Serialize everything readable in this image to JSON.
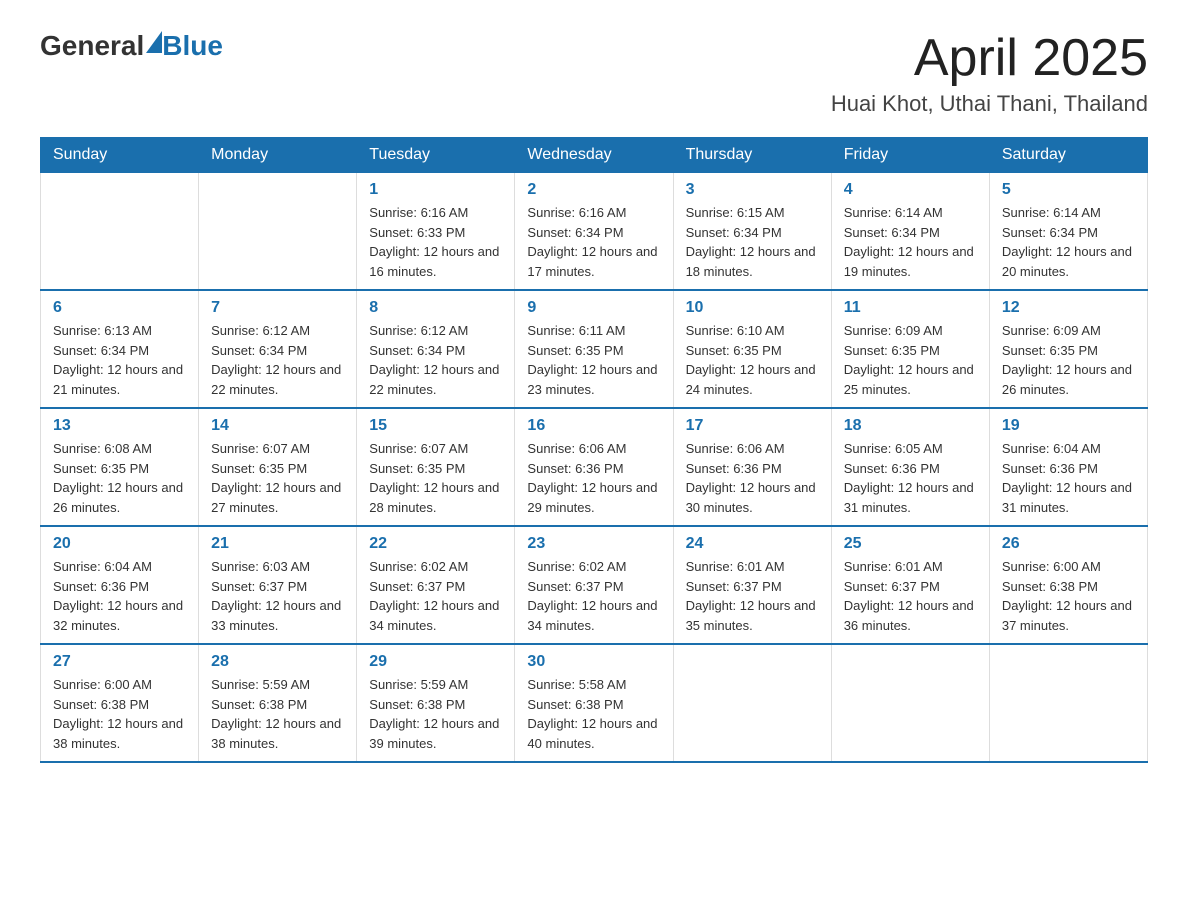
{
  "logo": {
    "text_general": "General",
    "text_blue": "Blue"
  },
  "title": "April 2025",
  "location": "Huai Khot, Uthai Thani, Thailand",
  "weekdays": [
    "Sunday",
    "Monday",
    "Tuesday",
    "Wednesday",
    "Thursday",
    "Friday",
    "Saturday"
  ],
  "weeks": [
    [
      {
        "day": "",
        "sunrise": "",
        "sunset": "",
        "daylight": ""
      },
      {
        "day": "",
        "sunrise": "",
        "sunset": "",
        "daylight": ""
      },
      {
        "day": "1",
        "sunrise": "Sunrise: 6:16 AM",
        "sunset": "Sunset: 6:33 PM",
        "daylight": "Daylight: 12 hours and 16 minutes."
      },
      {
        "day": "2",
        "sunrise": "Sunrise: 6:16 AM",
        "sunset": "Sunset: 6:34 PM",
        "daylight": "Daylight: 12 hours and 17 minutes."
      },
      {
        "day": "3",
        "sunrise": "Sunrise: 6:15 AM",
        "sunset": "Sunset: 6:34 PM",
        "daylight": "Daylight: 12 hours and 18 minutes."
      },
      {
        "day": "4",
        "sunrise": "Sunrise: 6:14 AM",
        "sunset": "Sunset: 6:34 PM",
        "daylight": "Daylight: 12 hours and 19 minutes."
      },
      {
        "day": "5",
        "sunrise": "Sunrise: 6:14 AM",
        "sunset": "Sunset: 6:34 PM",
        "daylight": "Daylight: 12 hours and 20 minutes."
      }
    ],
    [
      {
        "day": "6",
        "sunrise": "Sunrise: 6:13 AM",
        "sunset": "Sunset: 6:34 PM",
        "daylight": "Daylight: 12 hours and 21 minutes."
      },
      {
        "day": "7",
        "sunrise": "Sunrise: 6:12 AM",
        "sunset": "Sunset: 6:34 PM",
        "daylight": "Daylight: 12 hours and 22 minutes."
      },
      {
        "day": "8",
        "sunrise": "Sunrise: 6:12 AM",
        "sunset": "Sunset: 6:34 PM",
        "daylight": "Daylight: 12 hours and 22 minutes."
      },
      {
        "day": "9",
        "sunrise": "Sunrise: 6:11 AM",
        "sunset": "Sunset: 6:35 PM",
        "daylight": "Daylight: 12 hours and 23 minutes."
      },
      {
        "day": "10",
        "sunrise": "Sunrise: 6:10 AM",
        "sunset": "Sunset: 6:35 PM",
        "daylight": "Daylight: 12 hours and 24 minutes."
      },
      {
        "day": "11",
        "sunrise": "Sunrise: 6:09 AM",
        "sunset": "Sunset: 6:35 PM",
        "daylight": "Daylight: 12 hours and 25 minutes."
      },
      {
        "day": "12",
        "sunrise": "Sunrise: 6:09 AM",
        "sunset": "Sunset: 6:35 PM",
        "daylight": "Daylight: 12 hours and 26 minutes."
      }
    ],
    [
      {
        "day": "13",
        "sunrise": "Sunrise: 6:08 AM",
        "sunset": "Sunset: 6:35 PM",
        "daylight": "Daylight: 12 hours and 26 minutes."
      },
      {
        "day": "14",
        "sunrise": "Sunrise: 6:07 AM",
        "sunset": "Sunset: 6:35 PM",
        "daylight": "Daylight: 12 hours and 27 minutes."
      },
      {
        "day": "15",
        "sunrise": "Sunrise: 6:07 AM",
        "sunset": "Sunset: 6:35 PM",
        "daylight": "Daylight: 12 hours and 28 minutes."
      },
      {
        "day": "16",
        "sunrise": "Sunrise: 6:06 AM",
        "sunset": "Sunset: 6:36 PM",
        "daylight": "Daylight: 12 hours and 29 minutes."
      },
      {
        "day": "17",
        "sunrise": "Sunrise: 6:06 AM",
        "sunset": "Sunset: 6:36 PM",
        "daylight": "Daylight: 12 hours and 30 minutes."
      },
      {
        "day": "18",
        "sunrise": "Sunrise: 6:05 AM",
        "sunset": "Sunset: 6:36 PM",
        "daylight": "Daylight: 12 hours and 31 minutes."
      },
      {
        "day": "19",
        "sunrise": "Sunrise: 6:04 AM",
        "sunset": "Sunset: 6:36 PM",
        "daylight": "Daylight: 12 hours and 31 minutes."
      }
    ],
    [
      {
        "day": "20",
        "sunrise": "Sunrise: 6:04 AM",
        "sunset": "Sunset: 6:36 PM",
        "daylight": "Daylight: 12 hours and 32 minutes."
      },
      {
        "day": "21",
        "sunrise": "Sunrise: 6:03 AM",
        "sunset": "Sunset: 6:37 PM",
        "daylight": "Daylight: 12 hours and 33 minutes."
      },
      {
        "day": "22",
        "sunrise": "Sunrise: 6:02 AM",
        "sunset": "Sunset: 6:37 PM",
        "daylight": "Daylight: 12 hours and 34 minutes."
      },
      {
        "day": "23",
        "sunrise": "Sunrise: 6:02 AM",
        "sunset": "Sunset: 6:37 PM",
        "daylight": "Daylight: 12 hours and 34 minutes."
      },
      {
        "day": "24",
        "sunrise": "Sunrise: 6:01 AM",
        "sunset": "Sunset: 6:37 PM",
        "daylight": "Daylight: 12 hours and 35 minutes."
      },
      {
        "day": "25",
        "sunrise": "Sunrise: 6:01 AM",
        "sunset": "Sunset: 6:37 PM",
        "daylight": "Daylight: 12 hours and 36 minutes."
      },
      {
        "day": "26",
        "sunrise": "Sunrise: 6:00 AM",
        "sunset": "Sunset: 6:38 PM",
        "daylight": "Daylight: 12 hours and 37 minutes."
      }
    ],
    [
      {
        "day": "27",
        "sunrise": "Sunrise: 6:00 AM",
        "sunset": "Sunset: 6:38 PM",
        "daylight": "Daylight: 12 hours and 38 minutes."
      },
      {
        "day": "28",
        "sunrise": "Sunrise: 5:59 AM",
        "sunset": "Sunset: 6:38 PM",
        "daylight": "Daylight: 12 hours and 38 minutes."
      },
      {
        "day": "29",
        "sunrise": "Sunrise: 5:59 AM",
        "sunset": "Sunset: 6:38 PM",
        "daylight": "Daylight: 12 hours and 39 minutes."
      },
      {
        "day": "30",
        "sunrise": "Sunrise: 5:58 AM",
        "sunset": "Sunset: 6:38 PM",
        "daylight": "Daylight: 12 hours and 40 minutes."
      },
      {
        "day": "",
        "sunrise": "",
        "sunset": "",
        "daylight": ""
      },
      {
        "day": "",
        "sunrise": "",
        "sunset": "",
        "daylight": ""
      },
      {
        "day": "",
        "sunrise": "",
        "sunset": "",
        "daylight": ""
      }
    ]
  ]
}
